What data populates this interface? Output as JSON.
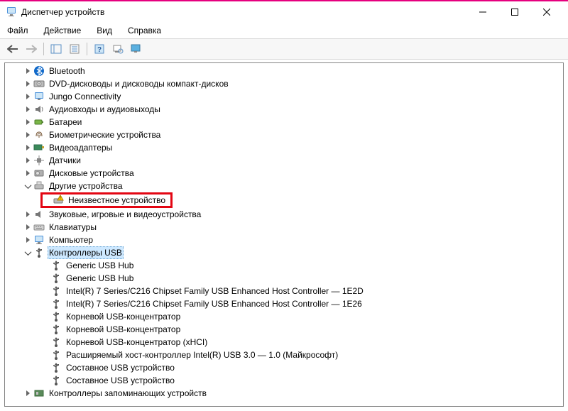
{
  "window": {
    "title": "Диспетчер устройств"
  },
  "menu": {
    "file": "Файл",
    "action": "Действие",
    "view": "Вид",
    "help": "Справка"
  },
  "tree": {
    "bluetooth": "Bluetooth",
    "dvd": "DVD-дисководы и дисководы компакт-дисков",
    "jungo": "Jungo Connectivity",
    "audio_io": "Аудиовходы и аудиовыходы",
    "batteries": "Батареи",
    "biometric": "Биометрические устройства",
    "video_adapters": "Видеоадаптеры",
    "sensors": "Датчики",
    "disk": "Дисковые устройства",
    "other": "Другие устройства",
    "unknown": "Неизвестное устройство",
    "sound_game": "Звуковые, игровые и видеоустройства",
    "keyboards": "Клавиатуры",
    "computer": "Компьютер",
    "usb_controllers": "Контроллеры USB",
    "usb": {
      "hub1": "Generic USB Hub",
      "hub2": "Generic USB Hub",
      "intel1": "Intel(R) 7 Series/C216 Chipset Family USB Enhanced Host Controller — 1E2D",
      "intel2": "Intel(R) 7 Series/C216 Chipset Family USB Enhanced Host Controller — 1E26",
      "root1": "Корневой USB-концентратор",
      "root2": "Корневой USB-концентратор",
      "root3": "Корневой USB-концентратор (xHCI)",
      "xhci": "Расширяемый хост-контроллер Intel(R) USB 3.0 — 1.0 (Майкрософт)",
      "comp1": "Составное USB устройство",
      "comp2": "Составное USB устройство"
    },
    "storage_ctrl": "Контроллеры запоминающих устройств"
  }
}
